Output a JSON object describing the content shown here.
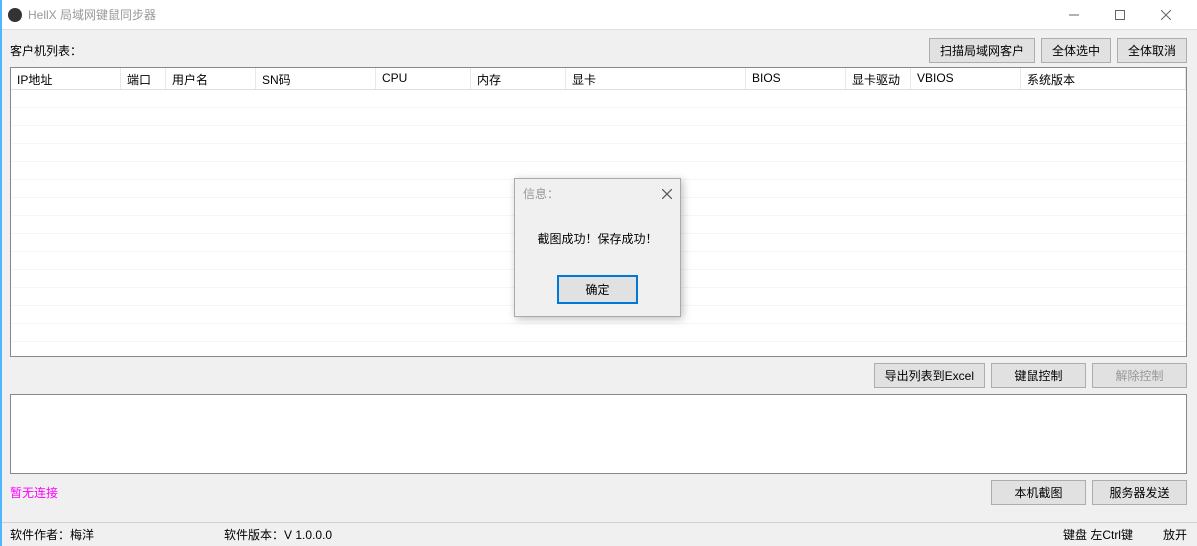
{
  "window": {
    "title": "HellX 局域网键鼠同步器"
  },
  "top": {
    "label": "客户机列表：",
    "scan": "扫描局域网客户",
    "select_all": "全体选中",
    "deselect_all": "全体取消"
  },
  "table": {
    "headers": {
      "ip": "IP地址",
      "port": "端口",
      "user": "用户名",
      "sn": "SN码",
      "cpu": "CPU",
      "mem": "内存",
      "gpu": "显卡",
      "bios": "BIOS",
      "gpudrv": "显卡驱动",
      "vbios": "VBIOS",
      "sysver": "系统版本"
    }
  },
  "mid": {
    "export": "导出列表到Excel",
    "control": "键鼠控制",
    "release": "解除控制"
  },
  "bottom": {
    "status": "暂无连接",
    "screenshot": "本机截图",
    "server_send": "服务器发送"
  },
  "status": {
    "author_label": "软件作者：",
    "author": "梅洋",
    "version_label": "软件版本：",
    "version": "V 1.0.0.0",
    "kb_label": "键盘",
    "kb_val": "左Ctrl键",
    "state": "放开"
  },
  "dialog": {
    "title": "信息：",
    "message": "截图成功！保存成功！",
    "ok": "确定"
  }
}
